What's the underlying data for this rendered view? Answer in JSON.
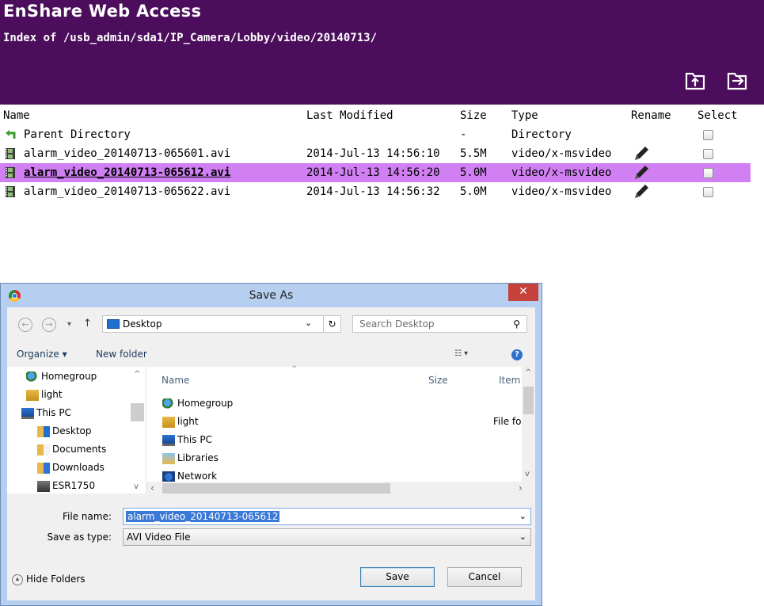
{
  "header": {
    "title": "EnShare Web Access",
    "path": "Index of /usb_admin/sda1/IP_Camera/Lobby/video/20140713/",
    "icons": [
      "upload-folder-icon",
      "new-folder-icon"
    ]
  },
  "listing": {
    "columns": {
      "name": "Name",
      "modified": "Last Modified",
      "size": "Size",
      "type": "Type",
      "rename": "Rename",
      "select": "Select"
    },
    "rows": [
      {
        "name": "Parent Directory",
        "modified": "",
        "size": "-",
        "type": "Directory",
        "icon": "parent-directory-icon"
      },
      {
        "name": "alarm_video_20140713-065601.avi",
        "modified": "2014-Jul-13 14:56:10",
        "size": "5.5M",
        "type": "video/x-msvideo",
        "icon": "video-file-icon"
      },
      {
        "name": "alarm_video_20140713-065612.avi",
        "modified": "2014-Jul-13 14:56:20",
        "size": "5.0M",
        "type": "video/x-msvideo",
        "icon": "video-file-icon",
        "highlighted": true
      },
      {
        "name": "alarm_video_20140713-065622.avi",
        "modified": "2014-Jul-13 14:56:32",
        "size": "5.0M",
        "type": "video/x-msvideo",
        "icon": "video-file-icon"
      }
    ],
    "highlight_color": "#d080f2"
  },
  "dialog": {
    "title": "Save As",
    "close_label": "✕",
    "address": "Desktop",
    "search_placeholder": "Search Desktop",
    "organize_label": "Organize ▾",
    "new_folder_label": "New folder",
    "nav_items": [
      {
        "label": "Homegroup",
        "icon": "homegroup-icon"
      },
      {
        "label": "light",
        "icon": "user-folder-icon"
      },
      {
        "label": "This PC",
        "icon": "computer-icon"
      },
      {
        "label": "Desktop",
        "icon": "desktop-folder-icon"
      },
      {
        "label": "Documents",
        "icon": "documents-folder-icon"
      },
      {
        "label": "Downloads",
        "icon": "downloads-folder-icon"
      },
      {
        "label": "ESR1750",
        "icon": "network-device-icon"
      }
    ],
    "file_columns": {
      "name": "Name",
      "size": "Size",
      "item": "Item"
    },
    "file_items": [
      {
        "label": "Homegroup",
        "icon": "homegroup-icon",
        "extra": ""
      },
      {
        "label": "light",
        "icon": "user-folder-icon",
        "extra": "File fo"
      },
      {
        "label": "This PC",
        "icon": "computer-icon",
        "extra": ""
      },
      {
        "label": "Libraries",
        "icon": "libraries-icon",
        "extra": ""
      },
      {
        "label": "Network",
        "icon": "network-icon",
        "extra": ""
      }
    ],
    "file_name_label": "File name:",
    "file_name_value": "alarm_video_20140713-065612",
    "save_type_label": "Save as type:",
    "save_type_value": "AVI Video File",
    "hide_folders_label": "Hide Folders",
    "save_label": "Save",
    "cancel_label": "Cancel"
  }
}
